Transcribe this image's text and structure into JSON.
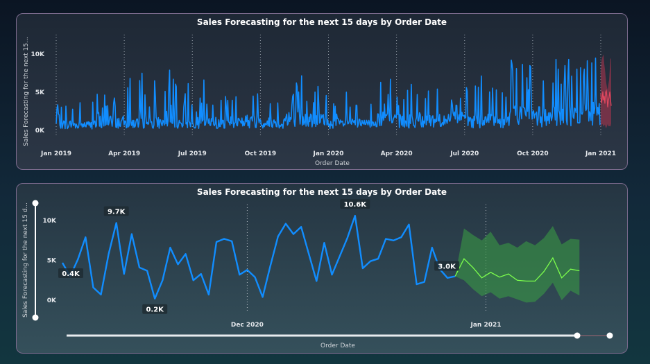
{
  "colors": {
    "actual": "#118dff",
    "forecast_band_top": "#b3344f",
    "forecast_band_bottom": "#3aa043",
    "forecast_line_bottom": "#7dff4c"
  },
  "chart_data": [
    {
      "type": "line",
      "title": "Sales Forecasting for the next 15 days by Order Date",
      "xlabel": "Order Date",
      "ylabel": "Sales Forecasting for the next 15...",
      "y_ticks": [
        "0K",
        "5K",
        "10K"
      ],
      "ylim": [
        0,
        12000
      ],
      "x_ticks": [
        "Jan 2019",
        "Apr 2019",
        "Jul 2019",
        "Oct 2019",
        "Jan 2020",
        "Apr 2020",
        "Jul 2020",
        "Oct 2020",
        "Jan 2021"
      ],
      "series": [
        {
          "values_by_month": [
            {
              "month": "2019-01",
              "typical": 1300,
              "peak": 3200
            },
            {
              "month": "2019-02",
              "typical": 1200,
              "peak": 5200
            },
            {
              "month": "2019-03",
              "typical": 1800,
              "peak": 9000
            },
            {
              "month": "2019-04",
              "typical": 1600,
              "peak": 7700
            },
            {
              "month": "2019-05",
              "typical": 1700,
              "peak": 8000
            },
            {
              "month": "2019-06",
              "typical": 1500,
              "peak": 7100
            },
            {
              "month": "2019-07",
              "typical": 1600,
              "peak": 6800
            },
            {
              "month": "2019-08",
              "typical": 1700,
              "peak": 6200
            },
            {
              "month": "2019-09",
              "typical": 2000,
              "peak": 7800
            },
            {
              "month": "2019-10",
              "typical": 1600,
              "peak": 6400
            },
            {
              "month": "2019-11",
              "typical": 2400,
              "peak": 8400
            },
            {
              "month": "2019-12",
              "typical": 2300,
              "peak": 7200
            },
            {
              "month": "2020-01",
              "typical": 1500,
              "peak": 5200
            },
            {
              "month": "2020-02",
              "typical": 1400,
              "peak": 4800
            },
            {
              "month": "2020-03",
              "typical": 2300,
              "peak": 7600
            },
            {
              "month": "2020-04",
              "typical": 2000,
              "peak": 6200
            },
            {
              "month": "2020-05",
              "typical": 2200,
              "peak": 6800
            },
            {
              "month": "2020-06",
              "typical": 2300,
              "peak": 7000
            },
            {
              "month": "2020-07",
              "typical": 2100,
              "peak": 8300
            },
            {
              "month": "2020-08",
              "typical": 2100,
              "peak": 6600
            },
            {
              "month": "2020-09",
              "typical": 3500,
              "peak": 10700
            },
            {
              "month": "2020-10",
              "typical": 3000,
              "peak": 9400
            },
            {
              "month": "2020-11",
              "typical": 3600,
              "peak": 10100
            },
            {
              "month": "2020-12",
              "typical": 3800,
              "peak": 10600
            }
          ]
        }
      ],
      "forecast": {
        "start": "2021-01-01",
        "days": 15,
        "low": 300,
        "high": 9500
      }
    },
    {
      "type": "line",
      "title": "Sales Forecasting for the next 15 days by Order Date",
      "xlabel": "Order Date",
      "ylabel": "Sales Forecasting for the next 15 d...",
      "y_ticks": [
        "0K",
        "5K",
        "10K"
      ],
      "ylim": [
        0,
        12000
      ],
      "x_ticks": [
        "Dec 2020",
        "Jan 2021"
      ],
      "x_start": "2020-11-07",
      "series": [
        {
          "values": [
            4700,
            3000,
            5100,
            7900,
            1600,
            700,
            5800,
            9700,
            3300,
            8300,
            4100,
            3700,
            200,
            2500,
            6600,
            4500,
            5800,
            2500,
            3300,
            700,
            7300,
            7700,
            7400,
            3200,
            3800,
            2900,
            400,
            4300,
            8000,
            9600,
            8300,
            9200,
            5800,
            2400,
            7200,
            3200,
            5500,
            7800,
            10600,
            4000,
            4900,
            5200,
            7700,
            7500,
            7900,
            9500,
            2000,
            2300,
            6600,
            3900,
            2800,
            3000
          ]
        }
      ],
      "data_labels": [
        {
          "text": "0.4K",
          "value": 400
        },
        {
          "text": "9.7K",
          "value": 9700
        },
        {
          "text": "0.2K",
          "value": 200
        },
        {
          "text": "10.6K",
          "value": 10600
        },
        {
          "text": "3.0K",
          "value": 3000
        }
      ],
      "forecast": {
        "start": "2021-01-01",
        "line": [
          5200,
          4100,
          2800,
          3500,
          2900,
          3300,
          2500,
          2400,
          2400,
          3600,
          5300,
          2800,
          3900,
          3700
        ],
        "upper": [
          9000,
          8200,
          7500,
          8600,
          6900,
          7200,
          6600,
          7400,
          6900,
          7800,
          9300,
          7000,
          7700,
          7600
        ],
        "lower": [
          2500,
          1400,
          500,
          1000,
          200,
          500,
          100,
          -300,
          -200,
          800,
          2200,
          0,
          1200,
          600
        ]
      },
      "range_slider": {
        "lower_handle": "start",
        "upper_handle_fraction": 0.94
      }
    }
  ]
}
